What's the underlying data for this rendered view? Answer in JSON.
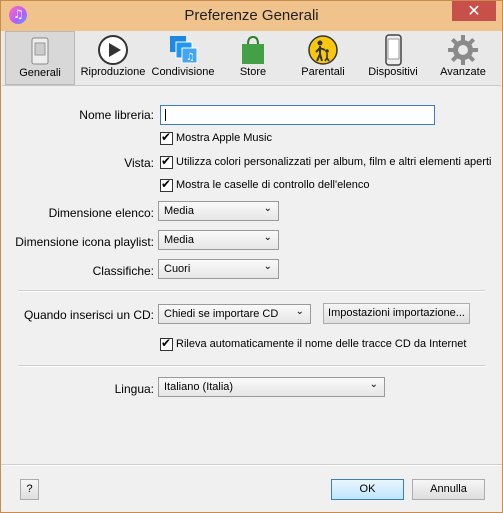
{
  "window": {
    "title": "Preferenze Generali",
    "close_glyph": "✕"
  },
  "toolbar": [
    {
      "label": "Generali",
      "icon": "general-icon"
    },
    {
      "label": "Riproduzione",
      "icon": "play-icon"
    },
    {
      "label": "Condivisione",
      "icon": "sharing-icon"
    },
    {
      "label": "Store",
      "icon": "store-bag-icon"
    },
    {
      "label": "Parentali",
      "icon": "parental-icon"
    },
    {
      "label": "Dispositivi",
      "icon": "device-icon"
    },
    {
      "label": "Avanzate",
      "icon": "gear-icon"
    }
  ],
  "form": {
    "library_name_label": "Nome libreria:",
    "library_name_value": "",
    "apple_music_label": "Mostra Apple Music",
    "view_label": "Vista:",
    "custom_colors_label": "Utilizza colori personalizzati per album, film e altri elementi aperti",
    "checkboxes_label": "Mostra le caselle di controllo dell'elenco",
    "list_size_label": "Dimensione elenco:",
    "list_size_value": "Media",
    "playlist_icon_label": "Dimensione icona playlist:",
    "playlist_icon_value": "Media",
    "ratings_label": "Classifiche:",
    "ratings_value": "Cuori",
    "cd_label": "Quando inserisci un CD:",
    "cd_value": "Chiedi se importare CD",
    "import_settings_button": "Impostazioni importazione...",
    "cd_names_label": "Rileva automaticamente il nome delle tracce CD da Internet",
    "language_label": "Lingua:",
    "language_value": "Italiano (Italia)"
  },
  "footer": {
    "help": "?",
    "ok": "OK",
    "cancel": "Annulla"
  },
  "colors": {
    "titlebar": "#f1c38c",
    "close": "#c7504b",
    "focus": "#3d7bd0"
  }
}
